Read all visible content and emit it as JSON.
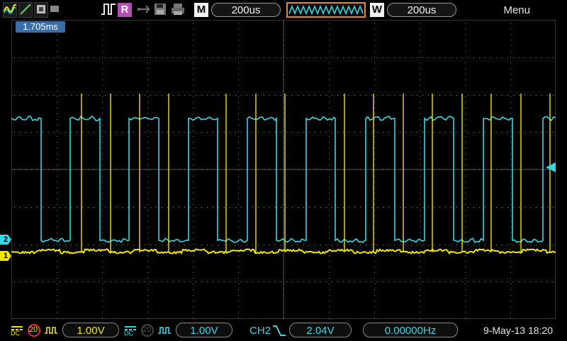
{
  "toolbar": {
    "timebase": "200us",
    "window_timebase": "200us",
    "m_label": "M",
    "w_label": "W",
    "r_label": "R",
    "menu_label": "Menu"
  },
  "screen": {
    "trigger_time": "1.705ms",
    "ch1_marker": "1",
    "ch2_marker": "2"
  },
  "bottom": {
    "ch1_coupling": "DC",
    "ch1_bw": "20",
    "ch1_scale": "1.00V",
    "ch2_coupling": "DC",
    "ch2_bw": "20",
    "ch2_scale": "1.00V",
    "trigger_source": "CH2",
    "trigger_level": "2.04V",
    "frequency": "0.00000Hz",
    "datetime": "9-May-13 18:20"
  },
  "colors": {
    "ch1": "#f2e600",
    "ch2": "#33d8e6",
    "grid": "#777777",
    "accent_orange": "#e58a2a"
  }
}
